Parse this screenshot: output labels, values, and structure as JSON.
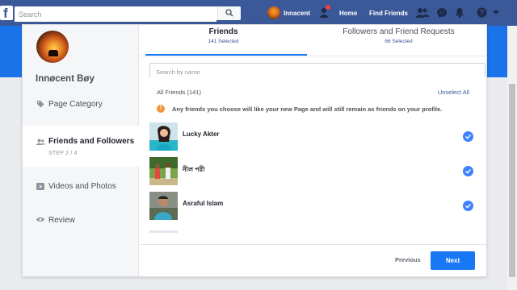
{
  "topbar": {
    "logo": "f",
    "search_placeholder": "Search",
    "profile_name": "Innacent",
    "home_label": "Home",
    "find_friends_label": "Find Friends"
  },
  "sidebar": {
    "page_name": "Innøcent Bøy",
    "items": [
      {
        "label": "Page Category",
        "icon": "tag-icon"
      },
      {
        "label": "Friends and Followers",
        "icon": "people-icon",
        "step": "STEP 2 / 4"
      },
      {
        "label": "Videos and Photos",
        "icon": "video-icon"
      },
      {
        "label": "Review",
        "icon": "eye-icon"
      }
    ]
  },
  "tabs": [
    {
      "label": "Friends",
      "count": "141 Selected"
    },
    {
      "label": "Followers and Friend Requests",
      "count": "66 Selected"
    }
  ],
  "search_name_placeholder": "Search by name",
  "all_friends_label": "All Friends (141)",
  "unselect_label": "Unselect All",
  "notice": "Any friends you choose will like your new Page and will still remain as friends on your profile.",
  "friends": [
    {
      "name": "Lucky Akter"
    },
    {
      "name": "নীল পরী"
    },
    {
      "name": "Asraful Islam"
    }
  ],
  "footer": {
    "previous_label": "Previous",
    "next_label": "Next"
  },
  "colors": {
    "topbar": "#3b5998",
    "accent": "#1877f2"
  }
}
